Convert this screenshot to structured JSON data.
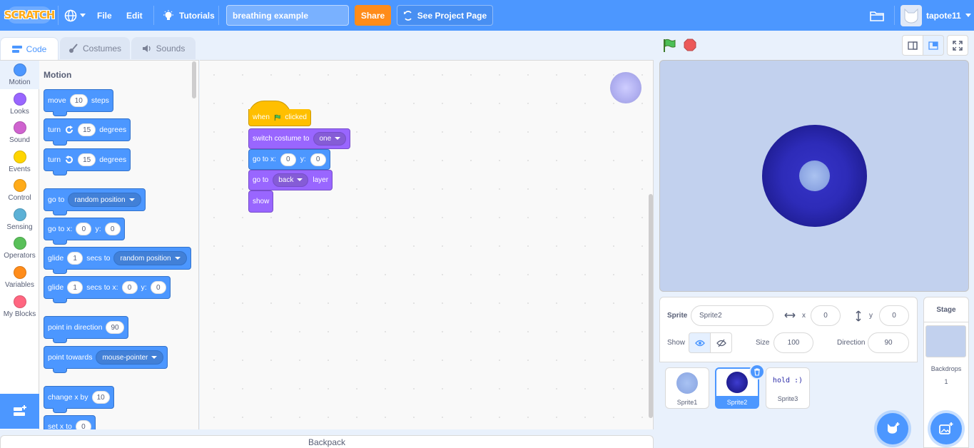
{
  "menu": {
    "logo": "SCRATCH",
    "file": "File",
    "edit": "Edit",
    "tutorials": "Tutorials",
    "project_title": "breathing example",
    "share": "Share",
    "see_project": "See Project Page",
    "username": "tapote11"
  },
  "tabs": {
    "code": "Code",
    "costumes": "Costumes",
    "sounds": "Sounds"
  },
  "categories": [
    {
      "label": "Motion",
      "color": "#4c97ff"
    },
    {
      "label": "Looks",
      "color": "#9966ff"
    },
    {
      "label": "Sound",
      "color": "#cf63cf"
    },
    {
      "label": "Events",
      "color": "#ffd500"
    },
    {
      "label": "Control",
      "color": "#ffab19"
    },
    {
      "label": "Sensing",
      "color": "#5cb1d6"
    },
    {
      "label": "Operators",
      "color": "#59c059"
    },
    {
      "label": "Variables",
      "color": "#ff8c1a"
    },
    {
      "label": "My Blocks",
      "color": "#ff6680"
    }
  ],
  "palette": {
    "title": "Motion",
    "move": {
      "a": "move",
      "v": "10",
      "b": "steps"
    },
    "turn_right": {
      "a": "turn",
      "v": "15",
      "b": "degrees"
    },
    "turn_left": {
      "a": "turn",
      "v": "15",
      "b": "degrees"
    },
    "goto": {
      "a": "go to",
      "dd": "random position"
    },
    "gotoxy": {
      "a": "go to x:",
      "x": "0",
      "b": "y:",
      "y": "0"
    },
    "glide_to": {
      "a": "glide",
      "v": "1",
      "b": "secs to",
      "dd": "random position"
    },
    "glide_xy": {
      "a": "glide",
      "v": "1",
      "b": "secs to x:",
      "x": "0",
      "c": "y:",
      "y": "0"
    },
    "point_dir": {
      "a": "point in direction",
      "v": "90"
    },
    "point_towards": {
      "a": "point towards",
      "dd": "mouse-pointer"
    },
    "change_x": {
      "a": "change x by",
      "v": "10"
    },
    "set_x": {
      "a": "set x to",
      "v": "0"
    }
  },
  "script": {
    "hat": {
      "a": "when",
      "b": "clicked"
    },
    "costume": {
      "a": "switch costume to",
      "dd": "one"
    },
    "gotoxy": {
      "a": "go to x:",
      "x": "0",
      "b": "y:",
      "y": "0"
    },
    "layer": {
      "a": "go to",
      "dd": "back",
      "b": "layer"
    },
    "show": "show"
  },
  "backpack": "Backpack",
  "sprite_info": {
    "sprite_label": "Sprite",
    "sprite_name": "Sprite2",
    "x_label": "x",
    "x": "0",
    "y_label": "y",
    "y": "0",
    "show_label": "Show",
    "size_label": "Size",
    "size": "100",
    "direction_label": "Direction",
    "direction": "90"
  },
  "sprites": [
    {
      "name": "Sprite1",
      "thumb": ""
    },
    {
      "name": "Sprite2",
      "thumb": ""
    },
    {
      "name": "Sprite3",
      "thumb": "hold :)"
    }
  ],
  "stage_panel": {
    "title": "Stage",
    "backdrops_label": "Backdrops",
    "backdrops_count": "1"
  },
  "colors": {
    "accent": "#4c97ff",
    "share": "#ff8c1a",
    "motion": "#4c97ff",
    "looks": "#9966ff",
    "events": "#ffbf00"
  }
}
